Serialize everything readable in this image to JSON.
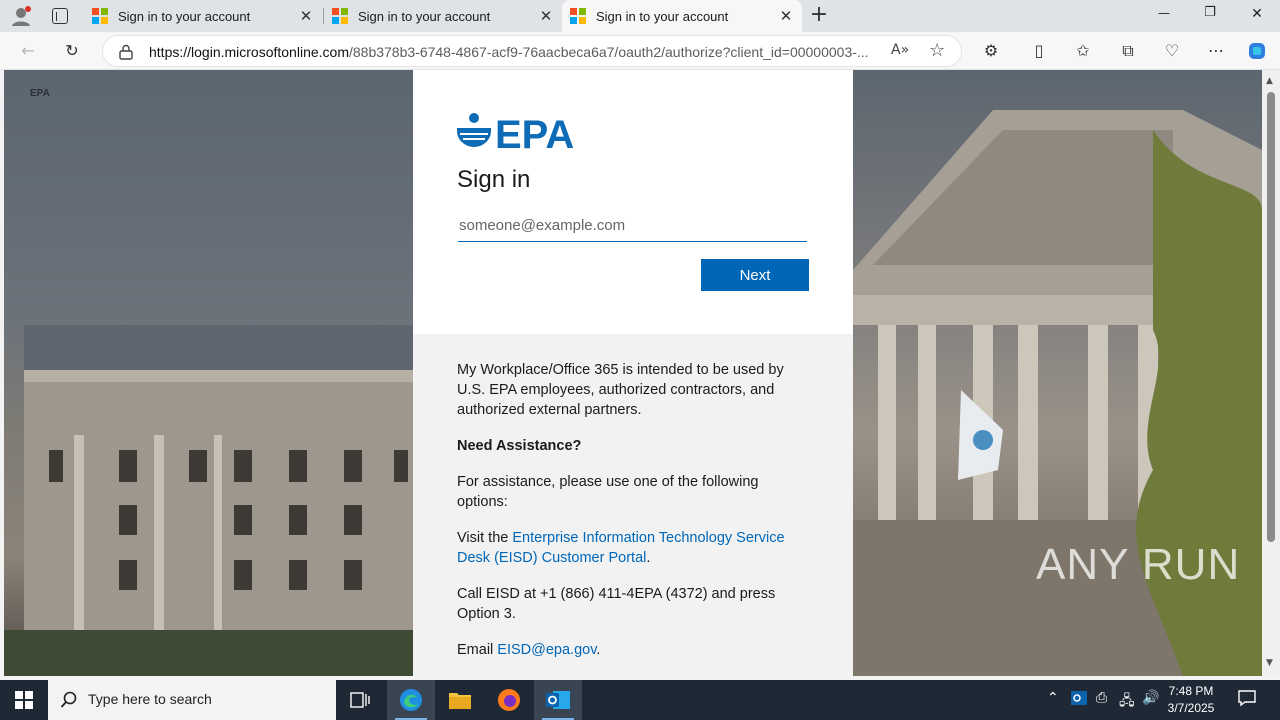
{
  "browser": {
    "tabs": [
      {
        "title": "Sign in to your account",
        "close": "✕"
      },
      {
        "title": "Sign in to your account",
        "close": "✕"
      },
      {
        "title": "Sign in to your account",
        "close": "✕"
      }
    ],
    "new_tab": "+",
    "url_host": "https://login.microsoftonline.com",
    "url_path": "/88b378b3-6748-4867-acf9-76aacbeca6a7/oauth2/authorize?client_id=00000003-...",
    "window_controls": {
      "minimize": "—",
      "restore": "❐",
      "close": "✕"
    }
  },
  "signin": {
    "logo_text": "EPA",
    "title": "Sign in",
    "email_placeholder": "someone@example.com",
    "next_label": "Next"
  },
  "info": {
    "para1": "My Workplace/Office 365 is intended to be used by U.S. EPA employees, authorized contractors, and authorized external partners.",
    "heading": "Need Assistance?",
    "para2": "For assistance, please use one of the following options:",
    "para3_prefix": "Visit the ",
    "para3_link": "Enterprise Information Technology Service Desk (EISD) Customer Portal",
    "para3_suffix": ".",
    "para4": "Call EISD at +1 (866) 411-4EPA (4372) and press Option 3.",
    "para5_prefix": "Email ",
    "para5_link": "EISD@epa.gov",
    "para5_suffix": "."
  },
  "corner_logo": "EPA",
  "watermark": "ANY RUN",
  "taskbar": {
    "search_placeholder": "Type here to search",
    "time": "7:48 PM",
    "date": "3/7/2025"
  },
  "colors": {
    "accent": "#0067b8",
    "epa_blue": "#0e6cb6"
  }
}
